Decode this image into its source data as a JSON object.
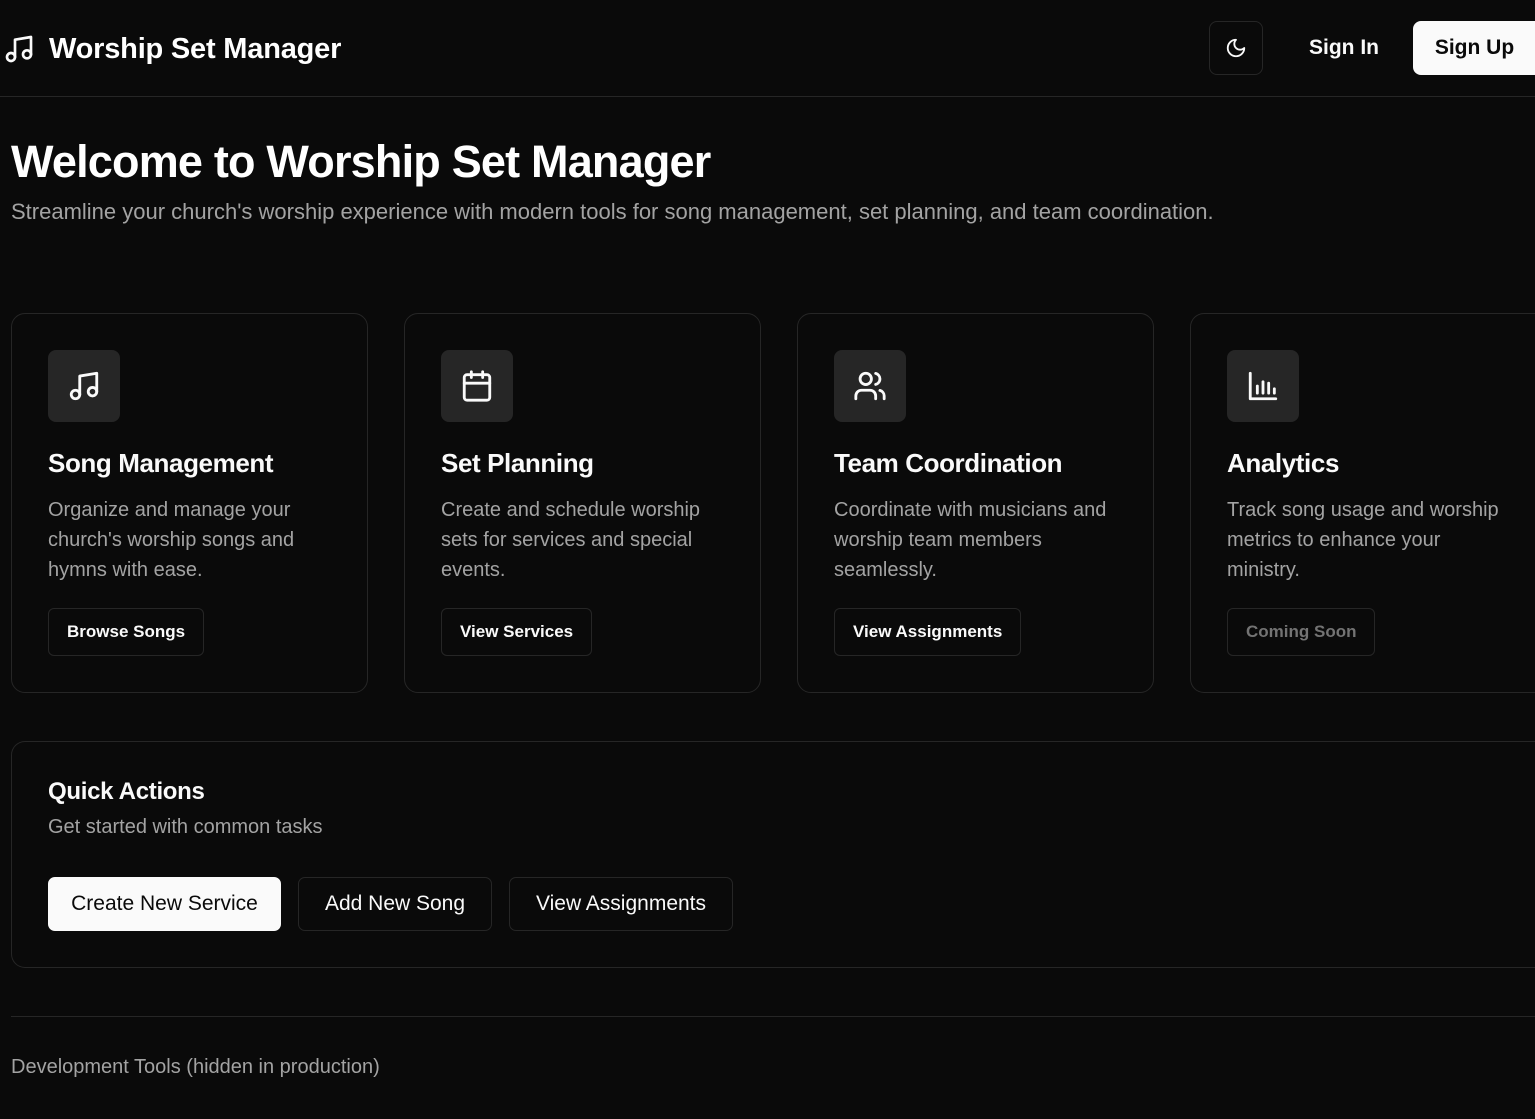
{
  "header": {
    "brand_title": "Worship Set Manager",
    "brand_icon": "music-note-icon",
    "theme_toggle_icon": "moon-icon",
    "sign_in_label": "Sign In",
    "sign_up_label": "Sign Up"
  },
  "hero": {
    "title": "Welcome to Worship Set Manager",
    "subtitle": "Streamline your church's worship experience with modern tools for song management, set planning, and team coordination."
  },
  "features": [
    {
      "icon": "music-note-icon",
      "title": "Song Management",
      "description": "Organize and manage your church's worship songs and hymns with ease.",
      "button_label": "Browse Songs"
    },
    {
      "icon": "calendar-icon",
      "title": "Set Planning",
      "description": "Create and schedule worship sets for services and special events.",
      "button_label": "View Services"
    },
    {
      "icon": "users-icon",
      "title": "Team Coordination",
      "description": "Coordinate with musicians and worship team members seamlessly.",
      "button_label": "View Assignments"
    },
    {
      "icon": "bar-chart-icon",
      "title": "Analytics",
      "description": "Track song usage and worship metrics to enhance your ministry.",
      "button_label": "Coming Soon"
    }
  ],
  "quick_actions": {
    "title": "Quick Actions",
    "subtitle": "Get started with common tasks",
    "buttons": [
      {
        "label": "Create New Service"
      },
      {
        "label": "Add New Song"
      },
      {
        "label": "View Assignments"
      }
    ]
  },
  "dev_tools": {
    "label": "Development Tools (hidden in production)"
  },
  "colors": {
    "background": "#0a0a0a",
    "border": "#262626",
    "foreground": "#fafafa",
    "muted": "#a3a3a3",
    "icon_box": "#262626"
  }
}
